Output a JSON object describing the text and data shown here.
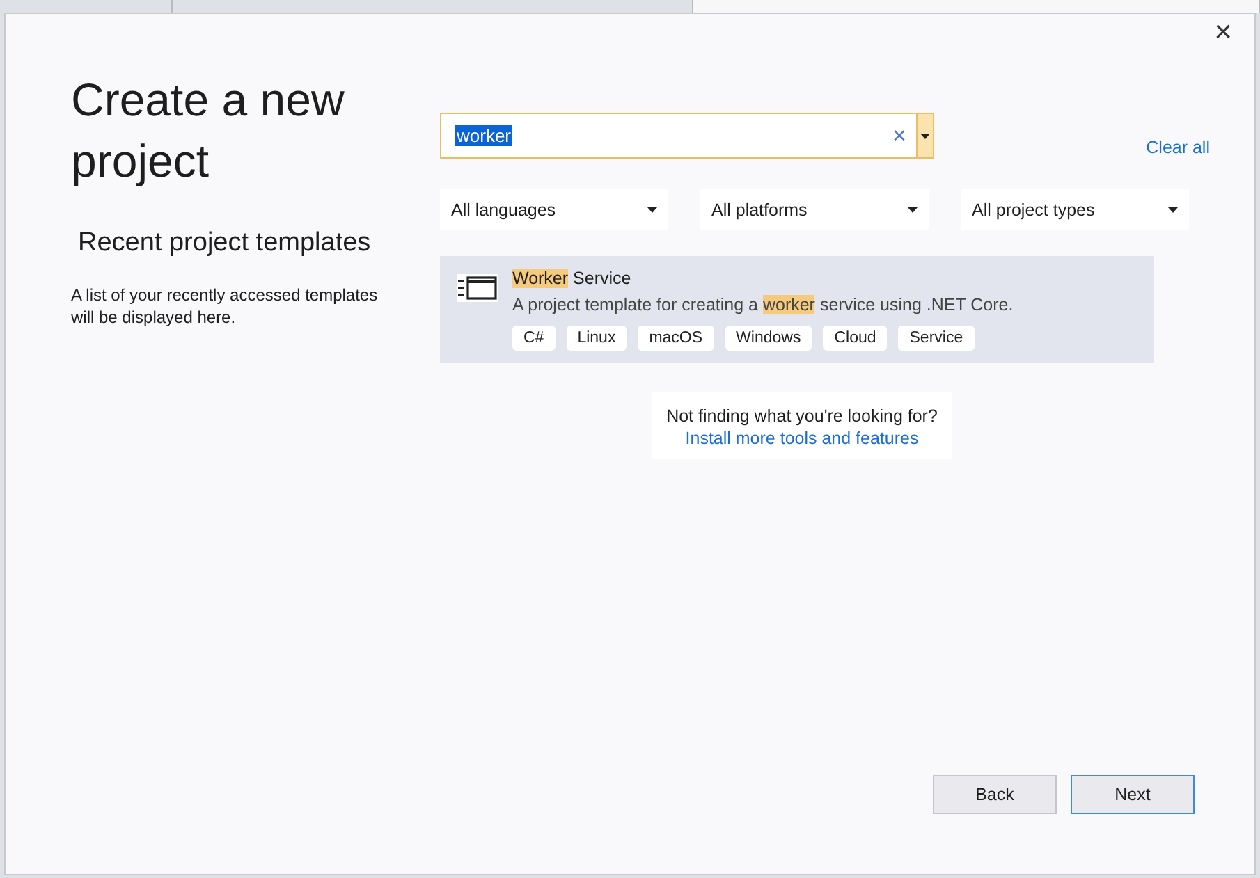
{
  "browser_tabs": [
    {
      "selected": false
    },
    {
      "selected": false
    },
    {
      "selected": true
    }
  ],
  "window": {
    "close": "×"
  },
  "title": "Create a new project",
  "recent": {
    "heading": "Recent project templates",
    "text": "A list of your recently accessed templates will be displayed here."
  },
  "search": {
    "value": "worker",
    "text_selected": true,
    "clear": "×"
  },
  "clear_all": "Clear all",
  "filters": [
    {
      "label": "All languages"
    },
    {
      "label": "All platforms"
    },
    {
      "label": "All project types"
    }
  ],
  "templates": [
    {
      "selected": true,
      "title": [
        {
          "text": "Worker",
          "highlight": true
        },
        {
          "text": " Service",
          "highlight": false
        }
      ],
      "description": [
        {
          "text": "A project template for creating a ",
          "highlight": false
        },
        {
          "text": "worker",
          "highlight": true
        },
        {
          "text": " service using .NET Core.",
          "highlight": false
        }
      ],
      "tags": [
        "C#",
        "Linux",
        "macOS",
        "Windows",
        "Cloud",
        "Service"
      ]
    }
  ],
  "not_finding": {
    "text": "Not finding what you're looking for?",
    "link": "Install more tools and features"
  },
  "buttons": [
    {
      "label": "Back",
      "primary": false
    },
    {
      "label": "Next",
      "primary": true
    }
  ]
}
